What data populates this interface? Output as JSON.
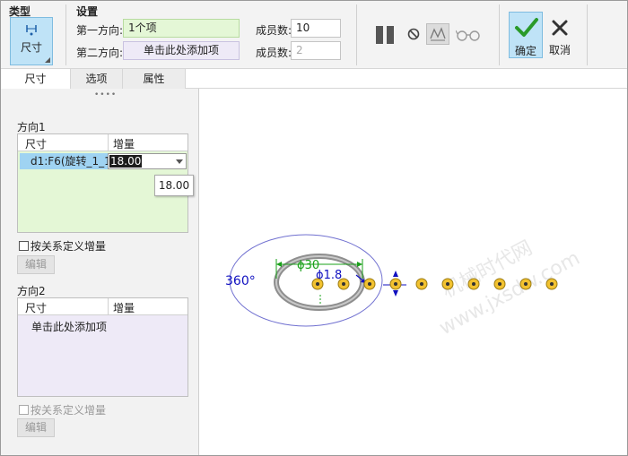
{
  "ribbon": {
    "type_group_label": "类型",
    "type_button_label": "尺寸",
    "settings_group_label": "设置",
    "dir1_label": "第一方向:",
    "dir1_value": "1个项",
    "dir2_label": "第二方向:",
    "dir2_value": "单击此处添加项",
    "members1_label": "成员数:",
    "members1_value": "10",
    "members2_label": "成员数:",
    "members2_value": "2",
    "ok_label": "确定",
    "cancel_label": "取消"
  },
  "tabs": [
    {
      "label": "尺寸",
      "active": true
    },
    {
      "label": "选项",
      "active": false
    },
    {
      "label": "属性",
      "active": false
    }
  ],
  "panel": {
    "grip": "••••",
    "direction1": {
      "label": "方向1",
      "col_dim": "尺寸",
      "col_inc": "增量",
      "row_dim": "d1:F6(旋转_1_1)",
      "row_inc": "18.00",
      "tooltip": "18.00"
    },
    "relation1_label": "按关系定义增量",
    "edit1_label": "编辑",
    "direction2": {
      "label": "方向2",
      "col_dim": "尺寸",
      "col_inc": "增量",
      "placeholder_row": "单击此处添加项"
    },
    "relation2_label": "按关系定义增量",
    "edit2_label": "编辑"
  },
  "canvas": {
    "angle_label": "360°",
    "diameter_label": "ϕ30",
    "small_diameter_label": "ϕ1.8",
    "watermark_line1": "机械时代网",
    "watermark_line2": "www.jxsdw.com",
    "pattern_member_count": 10
  },
  "colors": {
    "accent_blue": "#bfe3f7",
    "dim_green": "#1aa01a",
    "dim_blue": "#1010c0",
    "ellipse": "#7070d0",
    "member_yellow": "#f2c230"
  }
}
